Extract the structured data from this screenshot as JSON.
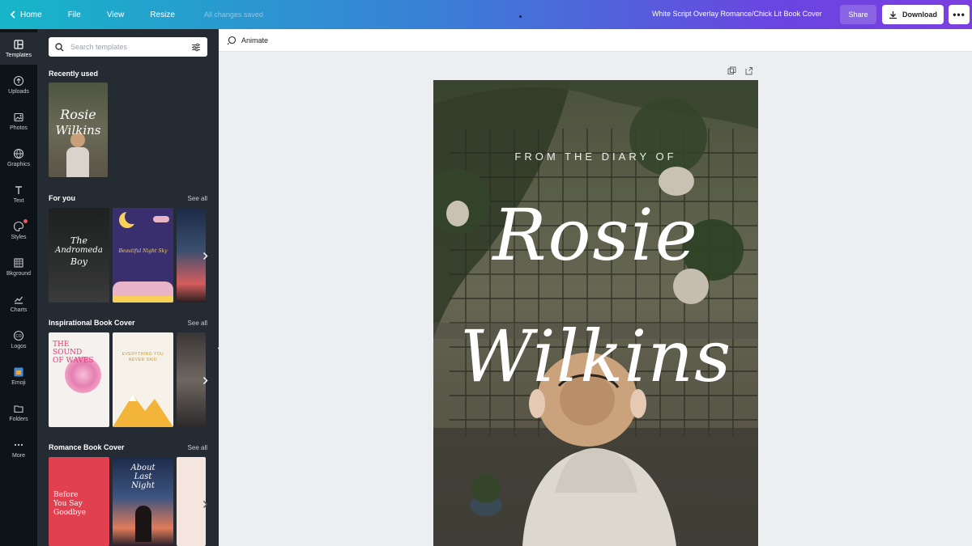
{
  "topbar": {
    "home": "Home",
    "file": "File",
    "view": "View",
    "resize": "Resize",
    "save_status": "All changes saved",
    "doc_title": "White Script Overlay Romance/Chick Lit Book Cover",
    "share": "Share",
    "download": "Download",
    "more": "•••"
  },
  "rail": [
    {
      "label": "Templates",
      "icon": "templates-icon"
    },
    {
      "label": "Uploads",
      "icon": "upload-icon"
    },
    {
      "label": "Photos",
      "icon": "photo-icon"
    },
    {
      "label": "Graphics",
      "icon": "graphics-icon"
    },
    {
      "label": "Text",
      "icon": "text-icon"
    },
    {
      "label": "Styles",
      "icon": "styles-icon"
    },
    {
      "label": "Bkground",
      "icon": "background-icon"
    },
    {
      "label": "Charts",
      "icon": "chart-icon"
    },
    {
      "label": "Logos",
      "icon": "logo-icon"
    },
    {
      "label": "Emoji",
      "icon": "emoji-icon"
    },
    {
      "label": "Folders",
      "icon": "folder-icon"
    },
    {
      "label": "More",
      "icon": "more-icon"
    }
  ],
  "panel": {
    "search_placeholder": "Search templates",
    "recently_used": "Recently used",
    "for_you": "For you",
    "inspirational": "Inspirational Book Cover",
    "romance": "Romance Book Cover",
    "see_all": "See all",
    "recent_thumb": {
      "line1": "Rosie",
      "line2": "Wilkins"
    },
    "for_you_thumbs": [
      {
        "title_l1": "The",
        "title_l2": "Andromeda",
        "title_l3": "Boy"
      },
      {
        "title_l1": "Beautiful Night Sky"
      }
    ],
    "inspirational_thumbs": [
      {
        "title_l1": "THE",
        "title_l2": "SOUND",
        "title_l3": "OF WAVES"
      },
      {
        "title_l1": "EVERYTHING YOU",
        "title_l2": "NEVER SAID"
      }
    ],
    "romance_thumbs": [
      {
        "title_l1": "Before",
        "title_l2": "You Say",
        "title_l3": "Goodbye"
      },
      {
        "title_l1": "About",
        "title_l2": "Last",
        "title_l3": "Night"
      }
    ]
  },
  "editor": {
    "animate": "Animate"
  },
  "cover": {
    "kicker": "FROM THE DIARY OF",
    "first_name": "Rosie",
    "last_name": "Wilkins"
  },
  "colors": {
    "rail_bg": "#0e1318",
    "panel_bg": "#252b33",
    "canvas_bg": "#eceef2",
    "gradient_start": "#16b6c8",
    "gradient_end": "#7b3fe0"
  }
}
